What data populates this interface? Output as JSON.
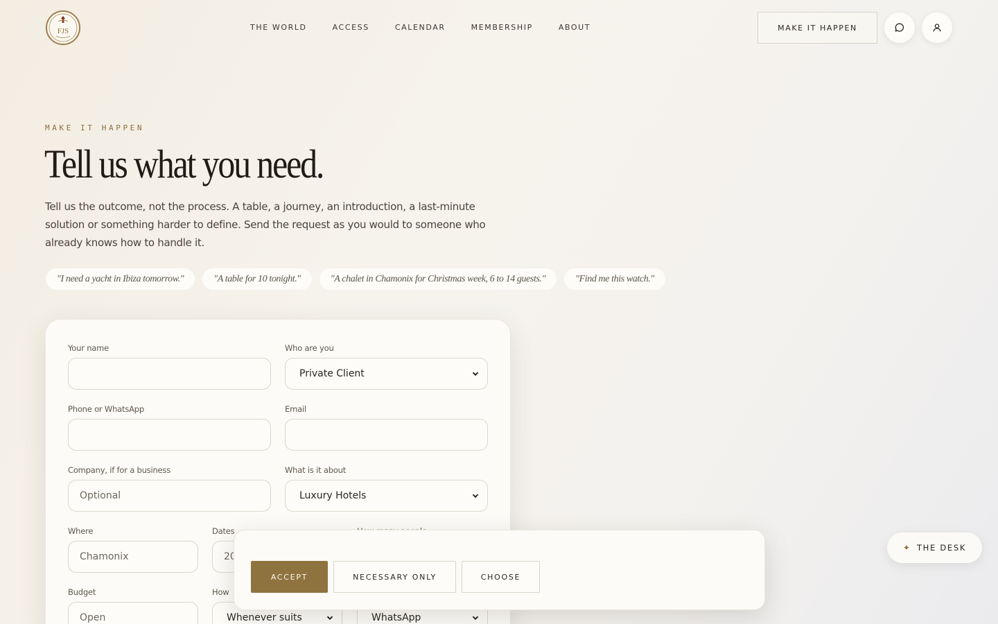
{
  "brand": {
    "logo_text": "FJS"
  },
  "nav": {
    "items": [
      {
        "label": "THE WORLD"
      },
      {
        "label": "ACCESS"
      },
      {
        "label": "CALENDAR"
      },
      {
        "label": "MEMBERSHIP"
      },
      {
        "label": "ABOUT"
      }
    ],
    "cta_label": "MAKE IT HAPPEN"
  },
  "hero": {
    "eyebrow": "MAKE IT HAPPEN",
    "title": "Tell us what you need.",
    "lede": "Tell us the outcome, not the process. A table, a journey, an introduction, a last-minute solution or something harder to define. Send the request as you would to someone who already knows how to handle it.",
    "examples": [
      "\"I need a yacht in Ibiza tomorrow.\"",
      "\"A table for 10 tonight.\"",
      "\"A chalet in Chamonix for Christmas week, 6 to 14 guests.\"",
      "\"Find me this watch.\""
    ]
  },
  "form": {
    "name": {
      "label": "Your name",
      "value": ""
    },
    "who": {
      "label": "Who are you",
      "value": "Private Client"
    },
    "phone": {
      "label": "Phone or WhatsApp",
      "value": ""
    },
    "email": {
      "label": "Email",
      "value": ""
    },
    "company": {
      "label": "Company, if for a business",
      "placeholder": "Optional"
    },
    "about": {
      "label": "What is it about",
      "value": "Luxury Hotels"
    },
    "where": {
      "label": "Where",
      "value": "Chamonix"
    },
    "dates": {
      "label": "Dates",
      "value": "20"
    },
    "people": {
      "label": "How many people"
    },
    "budget": {
      "label": "Budget",
      "value": "Open"
    },
    "when": {
      "label": "How",
      "value": "Whenever suits"
    },
    "contact": {
      "value": "WhatsApp"
    }
  },
  "cookie": {
    "accept": "ACCEPT",
    "necessary": "NECESSARY ONLY",
    "choose": "CHOOSE"
  },
  "desk": {
    "label": "THE DESK",
    "icon": "sparkle-icon"
  },
  "colors": {
    "accent": "#8f733f",
    "text": "#1f1b15"
  }
}
